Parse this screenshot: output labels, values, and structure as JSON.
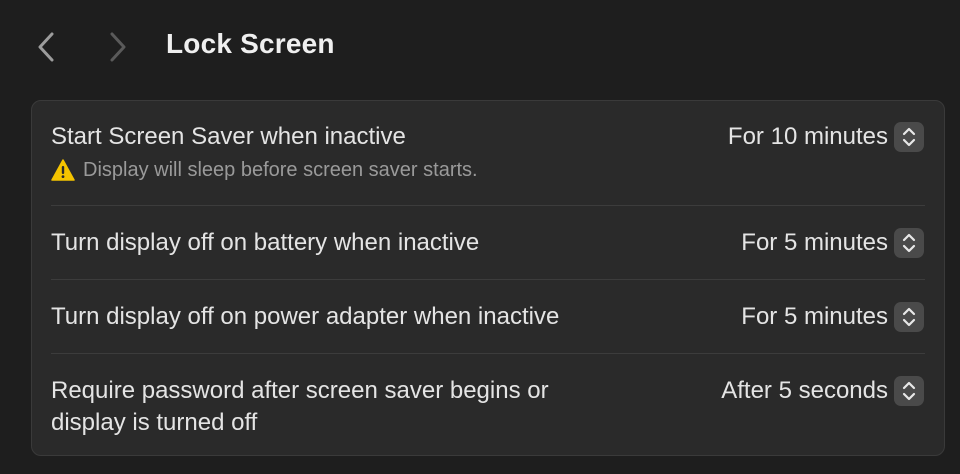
{
  "header": {
    "title": "Lock Screen",
    "back_icon": "chevron-left-icon",
    "forward_icon": "chevron-right-icon"
  },
  "settings": {
    "rows": [
      {
        "label": "Start Screen Saver when inactive",
        "warning": "Display will sleep before screen saver starts.",
        "warning_icon": "warning-icon",
        "value": "For 10 minutes"
      },
      {
        "label": "Turn display off on battery when inactive",
        "value": "For 5 minutes"
      },
      {
        "label": "Turn display off on power adapter when inactive",
        "value": "For 5 minutes"
      },
      {
        "label_line1": "Require password after screen saver begins or",
        "label_line2": "display is turned off",
        "value": "After 5 seconds"
      }
    ]
  },
  "colors": {
    "background": "#1e1e1e",
    "panel": "#2a2a2a",
    "warning": "#f5c400",
    "stepper": "#4a4a4a"
  }
}
